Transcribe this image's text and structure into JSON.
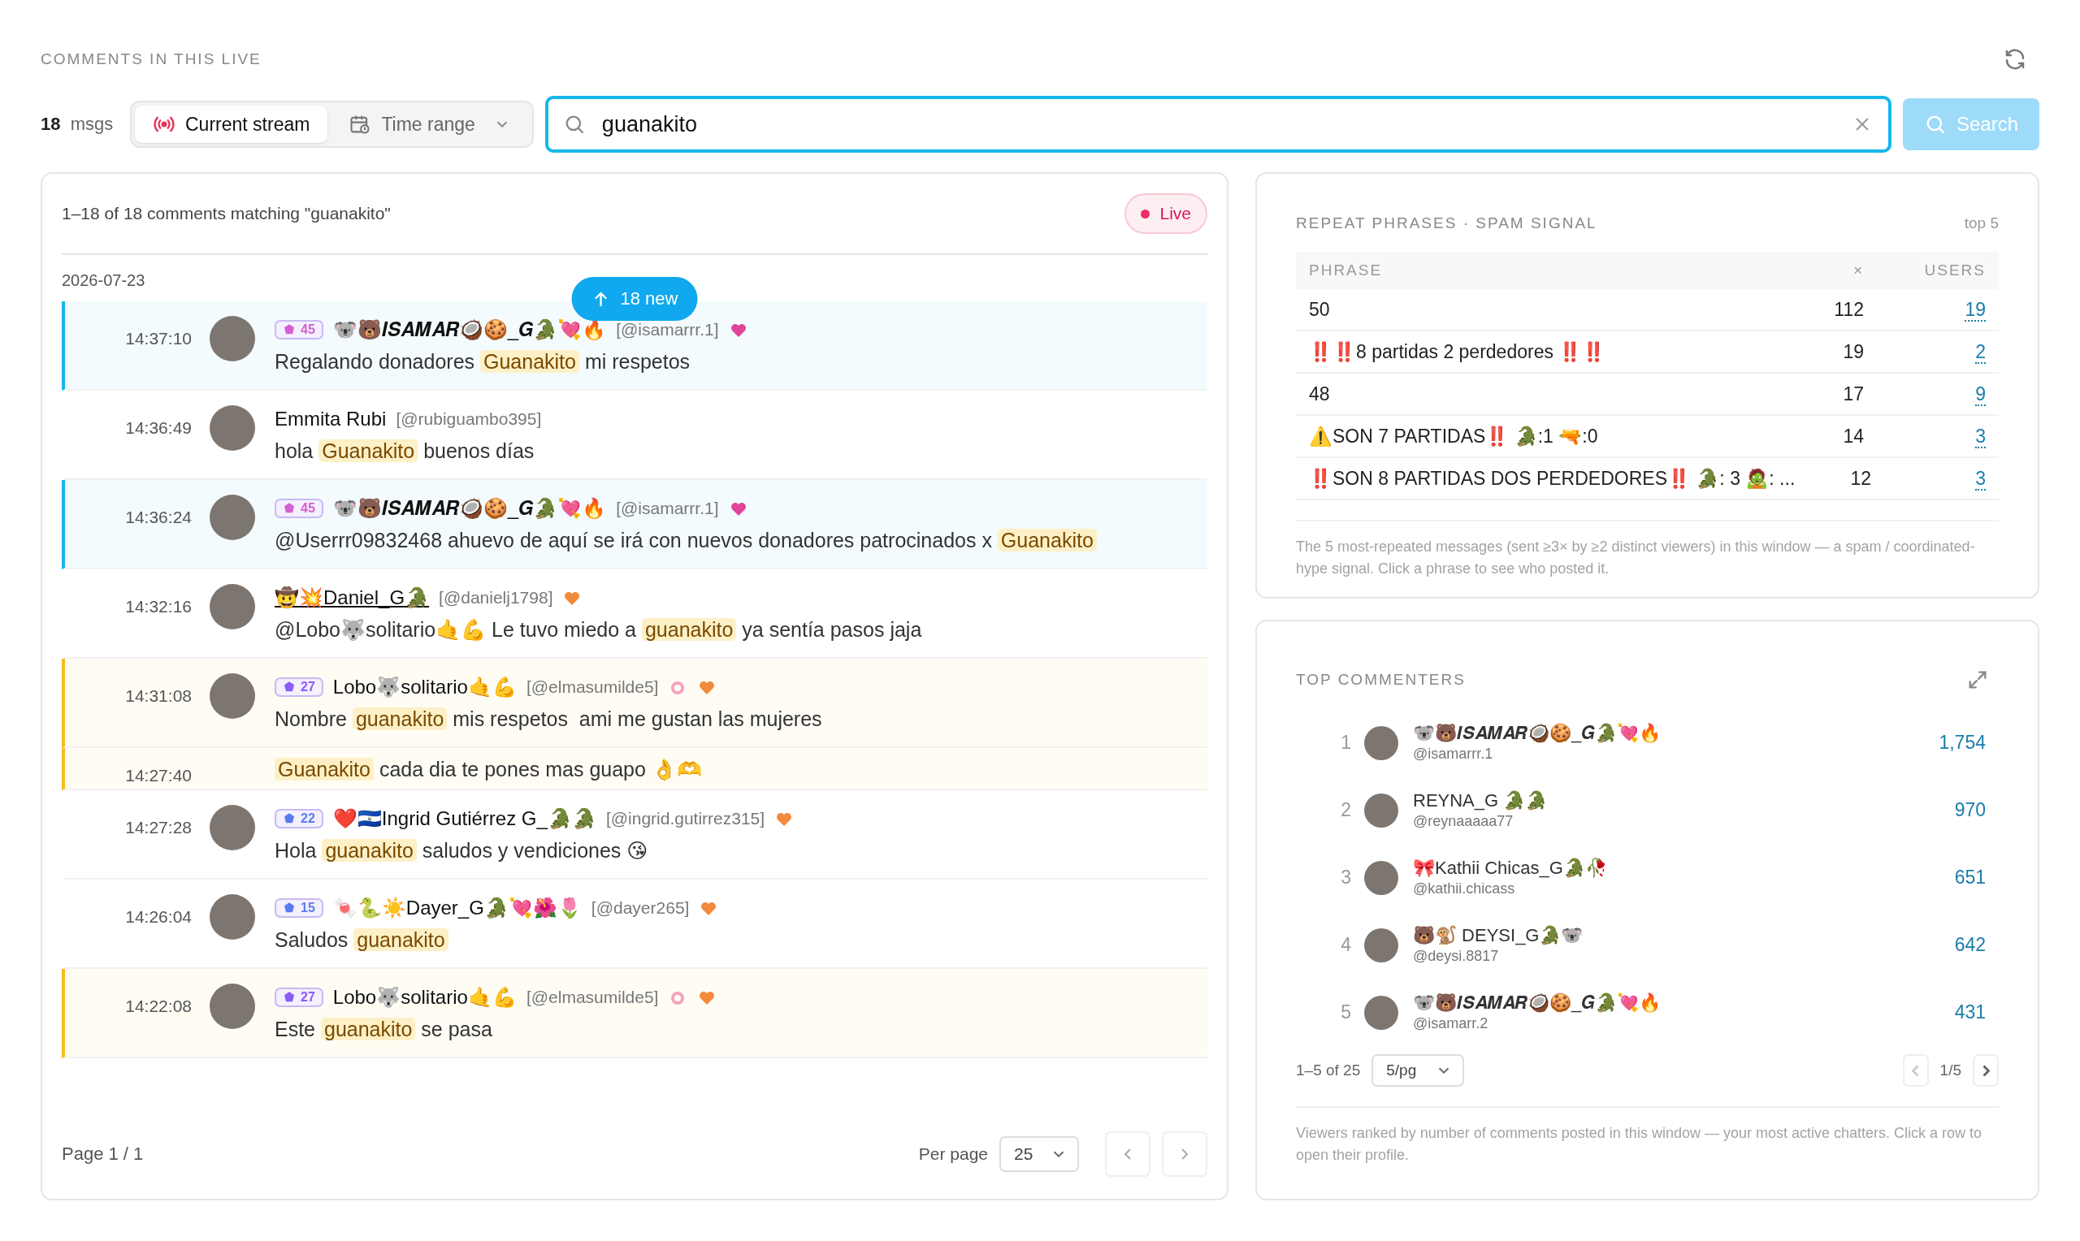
{
  "header": {
    "title": "COMMENTS IN THIS LIVE"
  },
  "toolbar": {
    "count": "18",
    "count_unit": "msgs",
    "modes": [
      {
        "label": "Current stream",
        "kind": "stream",
        "selected": true
      },
      {
        "label": "Time range",
        "kind": "range",
        "selected": false
      }
    ],
    "search": {
      "value": "guanakito"
    },
    "search_button": "Search"
  },
  "comments_panel": {
    "summary": "1–18 of 18 comments matching \"guanakito\"",
    "live_label": "Live",
    "date": "2026-07-23",
    "new_button": "18 new",
    "comments": [
      {
        "time": "14:37:10",
        "color": "#1ab4ee",
        "badge": {
          "text": "45",
          "color": "#d45fd0"
        },
        "name": "🐨🐻𝑰𝑺𝑨𝑴𝑨𝑹🥥🍪_𝑮🐊💘🔥",
        "underlined": false,
        "handle": "[@isamarrr.1]",
        "flair": [
          {
            "kind": "vip-heart"
          }
        ],
        "parts": [
          {
            "text": "Regalando donadores ",
            "match": false
          },
          {
            "text": "Guanakito",
            "match": true
          },
          {
            "text": " mi respetos",
            "match": false
          }
        ]
      },
      {
        "time": "14:36:49",
        "name": "Emmita Rubi",
        "underlined": false,
        "handle": "[@rubiguambo395]",
        "parts": [
          {
            "text": "hola ",
            "match": false
          },
          {
            "text": "Guanakito",
            "match": true
          },
          {
            "text": " buenos días",
            "match": false
          }
        ]
      },
      {
        "time": "14:36:24",
        "color": "#1ab4ee",
        "badge": {
          "text": "45",
          "color": "#d45fd0"
        },
        "name": "🐨🐻𝑰𝑺𝑨𝑴𝑨𝑹🥥🍪_𝑮🐊💘🔥",
        "underlined": false,
        "handle": "[@isamarrr.1]",
        "flair": [
          {
            "kind": "vip-heart"
          }
        ],
        "parts": [
          {
            "text": "@Userrr09832468 ahuevo de aquí se irá con nuevos donadores patrocinados x ",
            "match": false
          },
          {
            "text": "Guanakito",
            "match": true
          }
        ]
      },
      {
        "time": "14:32:16",
        "name": "🤠💥Daniel_G🐊",
        "underlined": true,
        "handle": "[@danielj1798]",
        "flair": [
          {
            "kind": "heart"
          }
        ],
        "parts": [
          {
            "text": "@Lobo🐺solitario🤙💪 Le tuvo miedo a ",
            "match": false
          },
          {
            "text": "guanakito",
            "match": true
          },
          {
            "text": " ya sentía pasos jaja",
            "match": false
          }
        ]
      },
      {
        "time": "14:31:08",
        "color": "#f6bb1e",
        "badge": {
          "text": "27",
          "color": "#8b5cf6"
        },
        "name": "Lobo🐺solitario🤙💪",
        "underlined": false,
        "handle": "[@elmasumilde5]",
        "flair": [
          {
            "kind": "medal"
          },
          {
            "kind": "heart"
          }
        ],
        "parts": [
          {
            "text": "Nombre ",
            "match": false
          },
          {
            "text": "guanakito",
            "match": true
          },
          {
            "text": " mis respetos  ami me gustan las mujeres",
            "match": false
          }
        ]
      },
      {
        "time": "14:27:40",
        "color": "#f6bb1e",
        "continuation": true,
        "parts": [
          {
            "text": "Guanakito",
            "match": true
          },
          {
            "text": " cada dia te pones mas guapo 👌🫶",
            "match": false
          }
        ]
      },
      {
        "time": "14:27:28",
        "badge": {
          "text": "22",
          "color": "#5b7cf0"
        },
        "name": "❤️🇸🇻Ingrid Gutiérrez G_🐊🐊",
        "underlined": false,
        "handle": "[@ingrid.gutirrez315]",
        "flair": [
          {
            "kind": "heart"
          }
        ],
        "parts": [
          {
            "text": "Hola ",
            "match": false
          },
          {
            "text": "guanakito",
            "match": true
          },
          {
            "text": " saludos y vendiciones 😘",
            "match": false
          }
        ]
      },
      {
        "time": "14:26:04",
        "badge": {
          "text": "15",
          "color": "#5b7cf0"
        },
        "name": "🍬🐍☀️Dayer_G🐊💘🌺🌷",
        "underlined": false,
        "handle": "[@dayer265]",
        "flair": [
          {
            "kind": "heart"
          }
        ],
        "parts": [
          {
            "text": "Saludos ",
            "match": false
          },
          {
            "text": "guanakito",
            "match": true
          }
        ]
      },
      {
        "time": "14:22:08",
        "color": "#f6bb1e",
        "badge": {
          "text": "27",
          "color": "#8b5cf6"
        },
        "name": "Lobo🐺solitario🤙💪",
        "underlined": false,
        "handle": "[@elmasumilde5]",
        "flair": [
          {
            "kind": "medal"
          },
          {
            "kind": "heart"
          }
        ],
        "parts": [
          {
            "text": "Este ",
            "match": false
          },
          {
            "text": "guanakito",
            "match": true
          },
          {
            "text": " se pasa",
            "match": false
          }
        ]
      }
    ],
    "footer": {
      "page": "Page 1 / 1",
      "per_page_label": "Per page",
      "per_page": "25"
    }
  },
  "repeat_phrases": {
    "title": "REPEAT PHRASES · SPAM SIGNAL",
    "scope": "top 5",
    "columns": [
      "PHRASE",
      "×",
      "USERS"
    ],
    "rows": [
      {
        "phrase": "50",
        "count": "112",
        "users": "19"
      },
      {
        "phrase": "‼️‼️8 partidas 2 perdedores ‼️‼️",
        "count": "19",
        "users": "2"
      },
      {
        "phrase": "48",
        "count": "17",
        "users": "9"
      },
      {
        "phrase": "⚠️SON 7 PARTIDAS‼️ 🐊:1 🔫:0",
        "count": "14",
        "users": "3"
      },
      {
        "phrase": "‼️SON 8 PARTIDAS DOS PERDEDORES‼️ 🐊: 3 🧟: ...",
        "count": "12",
        "users": "3"
      }
    ],
    "note": "The 5 most-repeated messages (sent ≥3× by ≥2 distinct viewers) in this window — a spam / coordinated-hype signal. Click a phrase to see who posted it."
  },
  "top_commenters": {
    "title": "TOP COMMENTERS",
    "rows": [
      {
        "rank": "1",
        "name": "🐨🐻𝑰𝑺𝑨𝑴𝑨𝑹🥥🍪_𝑮🐊💘🔥",
        "handle": "@isamarrr.1",
        "count": "1,754"
      },
      {
        "rank": "2",
        "name": "REYNA_G 🐊🐊",
        "handle": "@reynaaaaa77",
        "count": "970"
      },
      {
        "rank": "3",
        "name": "🎀Kathii Chicas_G🐊🥀",
        "handle": "@kathii.chicass",
        "count": "651"
      },
      {
        "rank": "4",
        "name": "🐻🐒 DEYSI_G🐊🐨",
        "handle": "@deysi.8817",
        "count": "642"
      },
      {
        "rank": "5",
        "name": "🐨🐻𝑰𝑺𝑨𝑴𝑨𝑹🥥🍪_𝑮🐊💘🔥",
        "handle": "@isamarr.2",
        "count": "431"
      }
    ],
    "range": "1–5 of 25",
    "per_page": "5/pg",
    "page": "1/5",
    "note": "Viewers ranked by number of comments posted in this window — your most active chatters. Click a row to open their profile."
  }
}
